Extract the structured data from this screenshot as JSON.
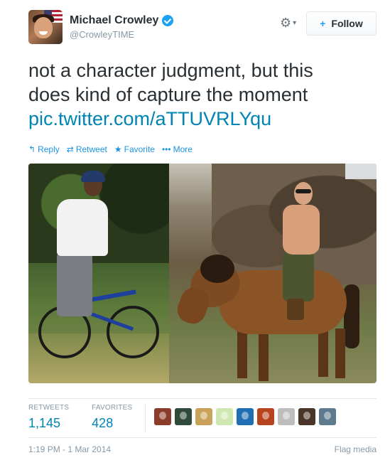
{
  "user": {
    "full_name": "Michael Crowley",
    "screen_name": "@CrowleyTIME",
    "verified": true
  },
  "follow_button": {
    "label": "Follow"
  },
  "tweet": {
    "text_line1": "not a character judgment, but this",
    "text_line2": "does kind of capture the moment",
    "link": "pic.twitter.com/aTTUVRLYqu"
  },
  "actions": [
    {
      "icon": "reply-icon",
      "label": "Reply"
    },
    {
      "icon": "retweet-icon",
      "label": "Retweet"
    },
    {
      "icon": "star-icon",
      "label": "Favorite"
    },
    {
      "icon": "more-icon",
      "label": "More"
    }
  ],
  "stats": {
    "retweets_label": "RETWEETS",
    "retweets_value": "1,145",
    "favorites_label": "FAVORITES",
    "favorites_value": "428"
  },
  "favoriter_colors": [
    "#8a3b2a",
    "#2f4a3a",
    "#c9a35a",
    "#cfe7b0",
    "#1f6fb5",
    "#b8441f",
    "#bdbdbd",
    "#4a3528",
    "#5d7a8f"
  ],
  "footer": {
    "timestamp": "1:19 PM - 1 Mar 2014",
    "flag_media": "Flag media"
  },
  "colors": {
    "link": "#0084b4",
    "action": "#1c94e0",
    "muted": "#8899a6",
    "verified": "#1da1f2"
  }
}
